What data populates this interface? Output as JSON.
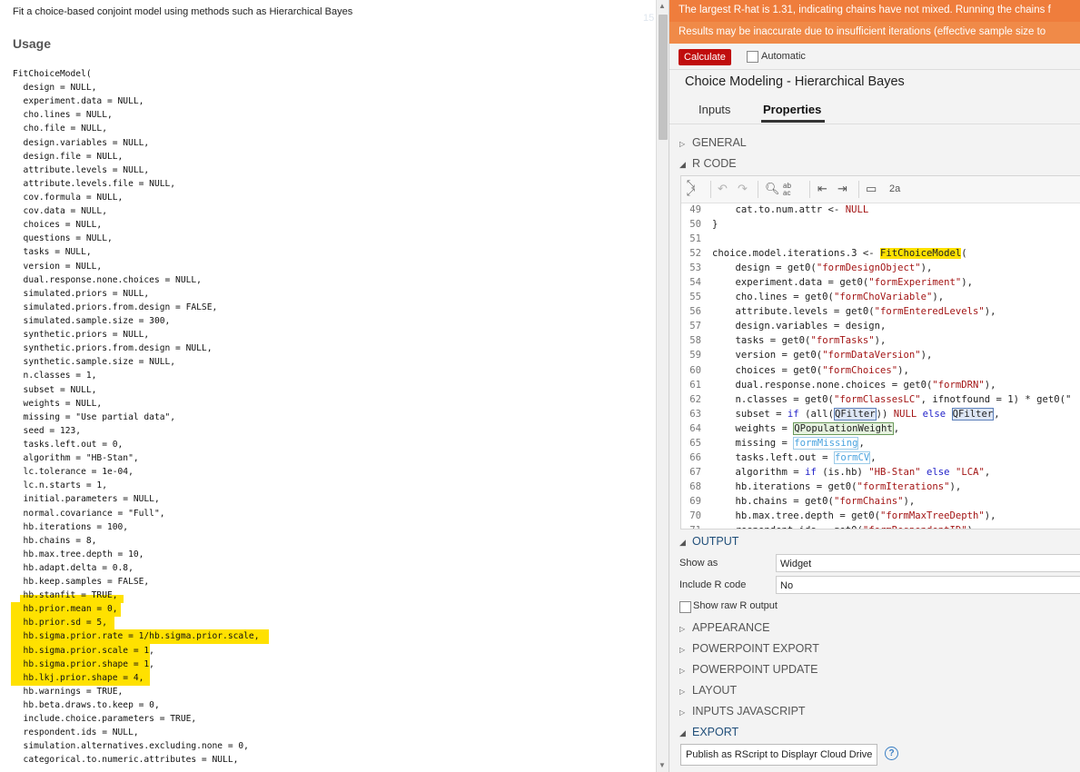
{
  "help": {
    "description": "Fit a choice-based conjoint model using methods such as Hierarchical Bayes",
    "usage_heading": "Usage",
    "code_lines": [
      "FitChoiceModel(",
      "  design = NULL,",
      "  experiment.data = NULL,",
      "  cho.lines = NULL,",
      "  cho.file = NULL,",
      "  design.variables = NULL,",
      "  design.file = NULL,",
      "  attribute.levels = NULL,",
      "  attribute.levels.file = NULL,",
      "  cov.formula = NULL,",
      "  cov.data = NULL,",
      "  choices = NULL,",
      "  questions = NULL,",
      "  tasks = NULL,",
      "  version = NULL,",
      "  dual.response.none.choices = NULL,",
      "  simulated.priors = NULL,",
      "  simulated.priors.from.design = FALSE,",
      "  simulated.sample.size = 300,",
      "  synthetic.priors = NULL,",
      "  synthetic.priors.from.design = NULL,",
      "  synthetic.sample.size = NULL,",
      "  n.classes = 1,",
      "  subset = NULL,",
      "  weights = NULL,",
      "  missing = \"Use partial data\",",
      "  seed = 123,",
      "  tasks.left.out = 0,",
      "  algorithm = \"HB-Stan\",",
      "  lc.tolerance = 1e-04,",
      "  lc.n.starts = 1,",
      "  initial.parameters = NULL,",
      "  normal.covariance = \"Full\",",
      "  hb.iterations = 100,",
      "  hb.chains = 8,",
      "  hb.max.tree.depth = 10,",
      "  hb.adapt.delta = 0.8,",
      "  hb.keep.samples = FALSE,",
      "  hb.stanfit = TRUE,",
      "  hb.prior.mean = 0,",
      "  hb.prior.sd = 5,",
      "  hb.sigma.prior.rate = 1/hb.sigma.prior.scale,",
      "  hb.sigma.prior.scale = 1,",
      "  hb.sigma.prior.shape = 1,",
      "  hb.lkj.prior.shape = 4,",
      "  hb.warnings = TRUE,",
      "  hb.beta.draws.to.keep = 0,",
      "  include.choice.parameters = TRUE,",
      "  respondent.ids = NULL,",
      "  simulation.alternatives.excluding.none = 0,",
      "  categorical.to.numeric.attributes = NULL,"
    ]
  },
  "warnings": [
    "The largest R-hat is 1.31, indicating chains have not mixed. Running the chains f",
    "Results may be inaccurate due to insufficient iterations (effective sample size to"
  ],
  "toolbar": {
    "calculate_label": "Calculate",
    "automatic_label": "Automatic"
  },
  "panel_title": "Choice Modeling - Hierarchical Bayes",
  "tabs": {
    "inputs": "Inputs",
    "properties": "Properties"
  },
  "sections": {
    "general": "GENERAL",
    "rcode": "R CODE",
    "output": "OUTPUT",
    "appearance": "APPEARANCE",
    "powerpoint_export": "POWERPOINT EXPORT",
    "powerpoint_update": "POWERPOINT UPDATE",
    "layout": "LAYOUT",
    "inputs_js": "INPUTS JAVASCRIPT",
    "export": "EXPORT"
  },
  "editor": {
    "toolbar_icons": [
      "expand-icon",
      "undo-icon",
      "redo-icon",
      "search-icon",
      "replace-icon",
      "indent-icon",
      "outdent-icon",
      "comment-icon",
      "font-size-icon"
    ],
    "font_size_label": "2a",
    "lines": [
      {
        "n": "49",
        "code": "    cat.to.num.attr <- NULL"
      },
      {
        "n": "50",
        "code": "}"
      },
      {
        "n": "51",
        "code": ""
      },
      {
        "n": "52",
        "code": "choice.model.iterations.3 <- FitChoiceModel("
      },
      {
        "n": "53",
        "code": "    design = get0(\"formDesignObject\"),"
      },
      {
        "n": "54",
        "code": "    experiment.data = get0(\"formExperiment\"),"
      },
      {
        "n": "55",
        "code": "    cho.lines = get0(\"formChoVariable\"),"
      },
      {
        "n": "56",
        "code": "    attribute.levels = get0(\"formEnteredLevels\"),"
      },
      {
        "n": "57",
        "code": "    design.variables = design,"
      },
      {
        "n": "58",
        "code": "    tasks = get0(\"formTasks\"),"
      },
      {
        "n": "59",
        "code": "    version = get0(\"formDataVersion\"),"
      },
      {
        "n": "60",
        "code": "    choices = get0(\"formChoices\"),"
      },
      {
        "n": "61",
        "code": "    dual.response.none.choices = get0(\"formDRN\"),"
      },
      {
        "n": "62",
        "code": "    n.classes = get0(\"formClassesLC\", ifnotfound = 1) * get0(\""
      },
      {
        "n": "63",
        "code": "    subset = if (all(QFilter)) NULL else QFilter,"
      },
      {
        "n": "64",
        "code": "    weights = QPopulationWeight,"
      },
      {
        "n": "65",
        "code": "    missing = formMissing,"
      },
      {
        "n": "66",
        "code": "    tasks.left.out = formCV,"
      },
      {
        "n": "67",
        "code": "    algorithm = if (is.hb) \"HB-Stan\" else \"LCA\","
      },
      {
        "n": "68",
        "code": "    hb.iterations = get0(\"formIterations\"),"
      },
      {
        "n": "69",
        "code": "    hb.chains = get0(\"formChains\"),"
      },
      {
        "n": "70",
        "code": "    hb.max.tree.depth = get0(\"formMaxTreeDepth\"),"
      },
      {
        "n": "71",
        "code": "    respondent.ids = get0(\"formRespondentID\")"
      }
    ]
  },
  "output": {
    "show_as_label": "Show as",
    "show_as_value": "Widget",
    "include_r_code_label": "Include R code",
    "include_r_code_value": "No",
    "show_raw_label": "Show raw R output"
  },
  "export": {
    "publish_label": "Publish as RScript to Displayr Cloud Drive",
    "help_glyph": "?"
  },
  "colors": {
    "warning": "#ef7d3c",
    "calculate": "#c00d0d",
    "highlight": "#ffe100",
    "section_blue": "#1f4e79"
  }
}
